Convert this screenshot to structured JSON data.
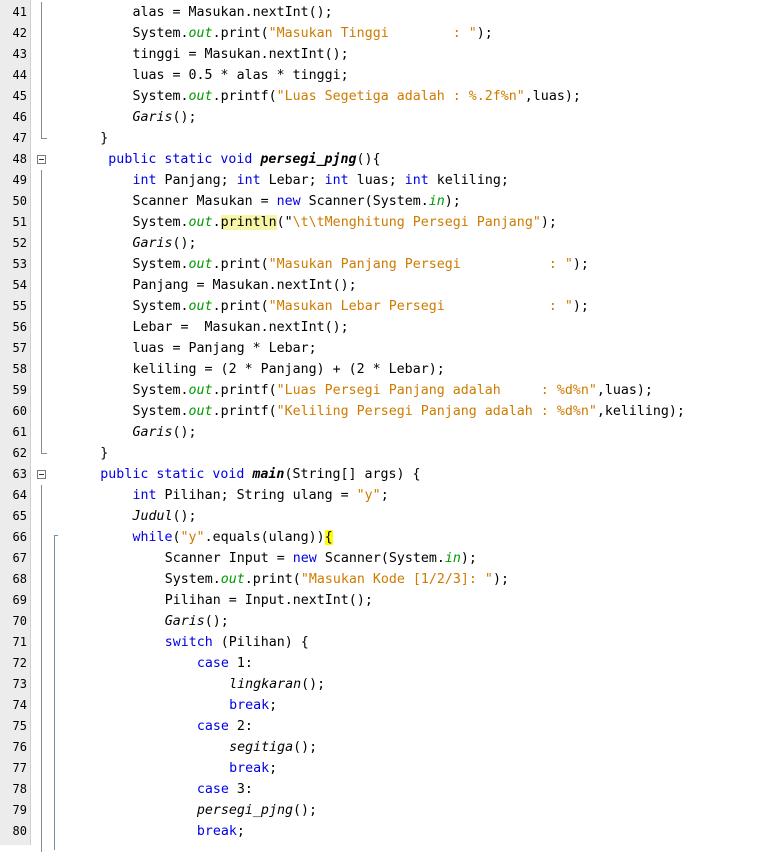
{
  "editor": {
    "first_line": 41,
    "line_height": 21,
    "lines": [
      {
        "n": "41",
        "indent": 10,
        "tokens": [
          {
            "t": "alas = Masukan.nextInt();"
          }
        ]
      },
      {
        "n": "42",
        "indent": 10,
        "tokens": [
          {
            "t": "System."
          },
          {
            "t": "out",
            "c": "fld"
          },
          {
            "t": ".print("
          },
          {
            "t": "\"Masukan Tinggi        : \"",
            "c": "str"
          },
          {
            "t": ");"
          }
        ]
      },
      {
        "n": "43",
        "indent": 10,
        "tokens": [
          {
            "t": "tinggi = Masukan.nextInt();"
          }
        ]
      },
      {
        "n": "44",
        "indent": 10,
        "tokens": [
          {
            "t": "luas = 0.5 * alas * tinggi;"
          }
        ]
      },
      {
        "n": "45",
        "indent": 10,
        "tokens": [
          {
            "t": "System."
          },
          {
            "t": "out",
            "c": "fld"
          },
          {
            "t": ".printf("
          },
          {
            "t": "\"Luas Segetiga adalah : %.2f%n\"",
            "c": "str"
          },
          {
            "t": ",luas);"
          }
        ]
      },
      {
        "n": "46",
        "indent": 10,
        "tokens": [
          {
            "t": "Garis",
            "c": "sm"
          },
          {
            "t": "();"
          }
        ]
      },
      {
        "n": "47",
        "indent": 6,
        "tokens": [
          {
            "t": "}"
          }
        ]
      },
      {
        "n": "48",
        "indent": 6,
        "tokens": [
          {
            "t": " public static void ",
            "c": "kw"
          },
          {
            "t": "persegi_pjng",
            "c": "bd"
          },
          {
            "t": "(){"
          }
        ]
      },
      {
        "n": "49",
        "indent": 10,
        "tokens": [
          {
            "t": "int",
            "c": "kw"
          },
          {
            "t": " Panjang; "
          },
          {
            "t": "int",
            "c": "kw"
          },
          {
            "t": " Lebar; "
          },
          {
            "t": "int",
            "c": "kw"
          },
          {
            "t": " luas; "
          },
          {
            "t": "int",
            "c": "kw"
          },
          {
            "t": " keliling;"
          }
        ]
      },
      {
        "n": "50",
        "indent": 10,
        "tokens": [
          {
            "t": "Scanner Masukan = "
          },
          {
            "t": "new",
            "c": "kw"
          },
          {
            "t": " Scanner(System."
          },
          {
            "t": "in",
            "c": "fld"
          },
          {
            "t": ");"
          }
        ]
      },
      {
        "n": "51",
        "indent": 10,
        "tokens": [
          {
            "t": "System."
          },
          {
            "t": "out",
            "c": "fld"
          },
          {
            "t": "."
          },
          {
            "t": "println",
            "c": "hl-method"
          },
          {
            "t": "(\""
          },
          {
            "t": "\\t\\tMenghitung Persegi Panjang\"",
            "c": "str"
          },
          {
            "t": ");"
          }
        ]
      },
      {
        "n": "52",
        "indent": 10,
        "tokens": [
          {
            "t": "Garis",
            "c": "sm"
          },
          {
            "t": "();"
          }
        ]
      },
      {
        "n": "53",
        "indent": 10,
        "tokens": [
          {
            "t": "System."
          },
          {
            "t": "out",
            "c": "fld"
          },
          {
            "t": ".print("
          },
          {
            "t": "\"Masukan Panjang Persegi           : \"",
            "c": "str"
          },
          {
            "t": ");"
          }
        ]
      },
      {
        "n": "54",
        "indent": 10,
        "tokens": [
          {
            "t": "Panjang = Masukan.nextInt();"
          }
        ]
      },
      {
        "n": "55",
        "indent": 10,
        "tokens": [
          {
            "t": "System."
          },
          {
            "t": "out",
            "c": "fld"
          },
          {
            "t": ".print("
          },
          {
            "t": "\"Masukan Lebar Persegi             : \"",
            "c": "str"
          },
          {
            "t": ");"
          }
        ]
      },
      {
        "n": "56",
        "indent": 10,
        "tokens": [
          {
            "t": "Lebar =  Masukan.nextInt();"
          }
        ]
      },
      {
        "n": "57",
        "indent": 10,
        "tokens": [
          {
            "t": "luas = Panjang * Lebar;"
          }
        ]
      },
      {
        "n": "58",
        "indent": 10,
        "tokens": [
          {
            "t": "keliling = (2 * Panjang) + (2 * Lebar);"
          }
        ]
      },
      {
        "n": "59",
        "indent": 10,
        "tokens": [
          {
            "t": "System."
          },
          {
            "t": "out",
            "c": "fld"
          },
          {
            "t": ".printf("
          },
          {
            "t": "\"Luas Persegi Panjang adalah     : %d%n\"",
            "c": "str"
          },
          {
            "t": ",luas);"
          }
        ]
      },
      {
        "n": "60",
        "indent": 10,
        "tokens": [
          {
            "t": "System."
          },
          {
            "t": "out",
            "c": "fld"
          },
          {
            "t": ".printf("
          },
          {
            "t": "\"Keliling Persegi Panjang adalah : %d%n\"",
            "c": "str"
          },
          {
            "t": ",keliling);"
          }
        ]
      },
      {
        "n": "61",
        "indent": 10,
        "tokens": [
          {
            "t": "Garis",
            "c": "sm"
          },
          {
            "t": "();"
          }
        ]
      },
      {
        "n": "62",
        "indent": 6,
        "tokens": [
          {
            "t": "}"
          }
        ]
      },
      {
        "n": "63",
        "indent": 6,
        "tokens": [
          {
            "t": "public static void ",
            "c": "kw"
          },
          {
            "t": "main",
            "c": "bd"
          },
          {
            "t": "(String[] args) {"
          }
        ]
      },
      {
        "n": "64",
        "indent": 10,
        "tokens": [
          {
            "t": "int",
            "c": "kw"
          },
          {
            "t": " Pilihan; String ulang = "
          },
          {
            "t": "\"y\"",
            "c": "str"
          },
          {
            "t": ";"
          }
        ]
      },
      {
        "n": "65",
        "indent": 10,
        "tokens": [
          {
            "t": "Judul",
            "c": "sm"
          },
          {
            "t": "();"
          }
        ]
      },
      {
        "n": "66",
        "indent": 10,
        "tokens": [
          {
            "t": "while",
            "c": "kw"
          },
          {
            "t": "("
          },
          {
            "t": "\"y\"",
            "c": "str"
          },
          {
            "t": ".equals(ulang))"
          },
          {
            "t": "{",
            "c": "hl-brace"
          }
        ]
      },
      {
        "n": "67",
        "indent": 14,
        "tokens": [
          {
            "t": "Scanner Input = "
          },
          {
            "t": "new",
            "c": "kw"
          },
          {
            "t": " Scanner(System."
          },
          {
            "t": "in",
            "c": "fld"
          },
          {
            "t": ");"
          }
        ]
      },
      {
        "n": "68",
        "indent": 14,
        "tokens": [
          {
            "t": "System."
          },
          {
            "t": "out",
            "c": "fld"
          },
          {
            "t": ".print("
          },
          {
            "t": "\"Masukan Kode [1/2/3]: \"",
            "c": "str"
          },
          {
            "t": ");"
          }
        ]
      },
      {
        "n": "69",
        "indent": 14,
        "tokens": [
          {
            "t": "Pilihan = Input.nextInt();"
          }
        ]
      },
      {
        "n": "70",
        "indent": 14,
        "tokens": [
          {
            "t": "Garis",
            "c": "sm"
          },
          {
            "t": "();"
          }
        ]
      },
      {
        "n": "71",
        "indent": 14,
        "tokens": [
          {
            "t": "switch",
            "c": "kw"
          },
          {
            "t": " (Pilihan) {"
          }
        ]
      },
      {
        "n": "72",
        "indent": 18,
        "tokens": [
          {
            "t": "case",
            "c": "kw"
          },
          {
            "t": " 1:"
          }
        ]
      },
      {
        "n": "73",
        "indent": 22,
        "tokens": [
          {
            "t": "lingkaran",
            "c": "sm"
          },
          {
            "t": "();"
          }
        ]
      },
      {
        "n": "74",
        "indent": 22,
        "tokens": [
          {
            "t": "break",
            "c": "kw"
          },
          {
            "t": ";"
          }
        ]
      },
      {
        "n": "75",
        "indent": 18,
        "tokens": [
          {
            "t": "case",
            "c": "kw"
          },
          {
            "t": " 2:"
          }
        ]
      },
      {
        "n": "76",
        "indent": 22,
        "tokens": [
          {
            "t": "segitiga",
            "c": "sm"
          },
          {
            "t": "();"
          }
        ]
      },
      {
        "n": "77",
        "indent": 22,
        "tokens": [
          {
            "t": "break",
            "c": "kw"
          },
          {
            "t": ";"
          }
        ]
      },
      {
        "n": "78",
        "indent": 18,
        "tokens": [
          {
            "t": "case",
            "c": "kw"
          },
          {
            "t": " 3:"
          }
        ]
      },
      {
        "n": "79",
        "indent": 18,
        "tokens": [
          {
            "t": "persegi_pjng",
            "c": "sm"
          },
          {
            "t": "();"
          }
        ]
      },
      {
        "n": "80",
        "indent": 18,
        "tokens": [
          {
            "t": "break",
            "c": "kw"
          },
          {
            "t": ";"
          }
        ]
      }
    ],
    "fold_markers": [
      48,
      63
    ]
  },
  "colors": {
    "keyword": "#0000e6",
    "string": "#ce7b00",
    "static_field": "#009900",
    "method_highlight": "#f6f6a6",
    "brace_highlight": "#ffff00"
  }
}
